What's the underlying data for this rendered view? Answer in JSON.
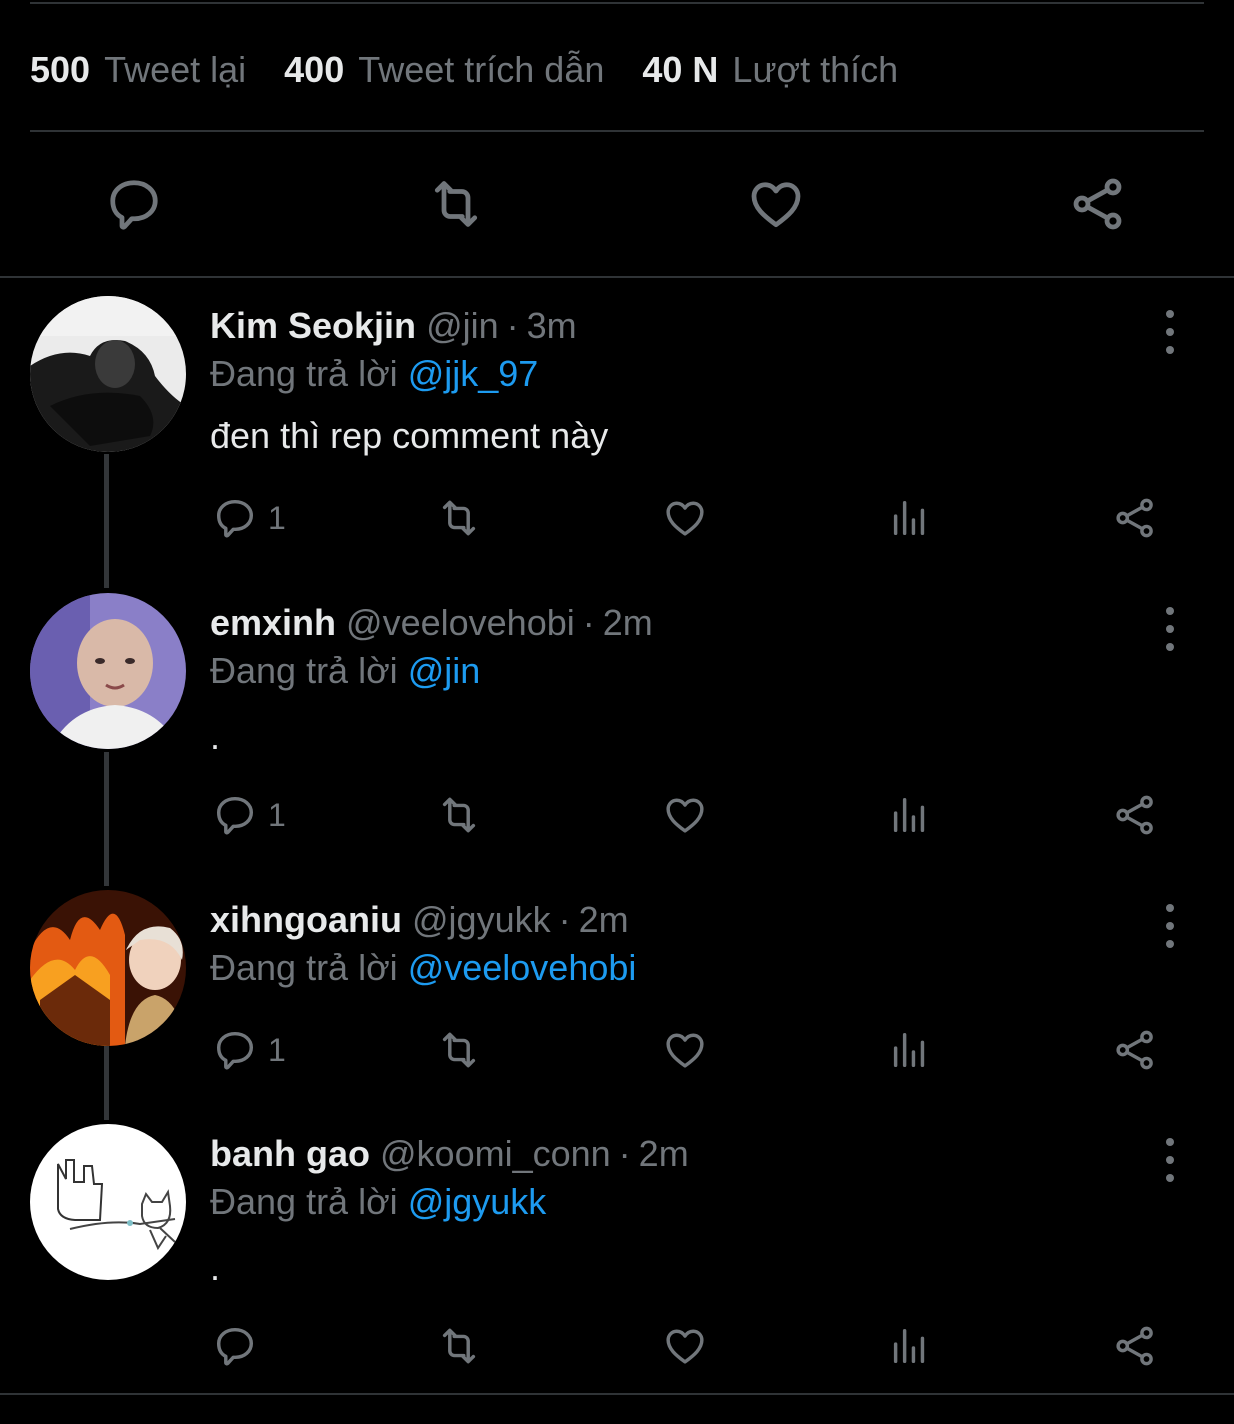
{
  "stats": [
    {
      "num": "500",
      "label": "Tweet lại"
    },
    {
      "num": "400",
      "label": "Tweet trích dẫn"
    },
    {
      "num": "40 N",
      "label": "Lượt thích"
    }
  ],
  "action_bar_icons": [
    "reply-icon",
    "retweet-icon",
    "like-icon",
    "share-icon"
  ],
  "replying_prefix": "Đang trả lời",
  "colors": {
    "background": "#000000",
    "text": "#e7e9ea",
    "muted": "#71767b",
    "link": "#1d9bf0",
    "divider": "#2f3336"
  },
  "replies": [
    {
      "name": "Kim Seokjin",
      "handle": "@jin",
      "dot": "·",
      "time": "3m",
      "reply_to": "@jjk_97",
      "text": "đen thì rep comment này",
      "reply_count": "1"
    },
    {
      "name": "emxinh",
      "handle": "@veelovehobi",
      "dot": "·",
      "time": "2m",
      "reply_to": "@jin",
      "text": ".",
      "reply_count": "1"
    },
    {
      "name": "xihngoaniu",
      "handle": "@jgyukk",
      "dot": "·",
      "time": "2m",
      "reply_to": "@veelovehobi",
      "text": "",
      "reply_count": "1"
    },
    {
      "name": "banh gao",
      "handle": "@koomi_conn",
      "dot": "·",
      "time": "2m",
      "reply_to": "@jgyukk",
      "text": ".",
      "reply_count": ""
    }
  ]
}
